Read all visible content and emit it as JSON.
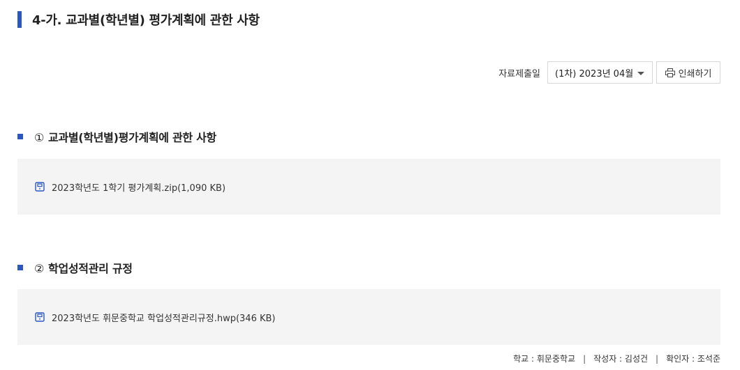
{
  "title": "4-가. 교과별(학년별) 평가계획에 관한 사항",
  "toolbar": {
    "submit_date_label": "자료제출일",
    "selected_period": "(1차) 2023년 04월",
    "print_label": "인쇄하기"
  },
  "sections": [
    {
      "number": "①",
      "heading": "교과별(학년별)평가계획에 관한 사항",
      "file": "2023학년도 1학기 평가계획.zip(1,090 KB)"
    },
    {
      "number": "②",
      "heading": "학업성적관리 규정",
      "file": "2023학년도 휘문중학교 학업성적관리규정.hwp(346 KB)"
    }
  ],
  "footer": {
    "school": "학교 : 휘문중학교",
    "author": "작성자 : 김성건",
    "confirmer": "확인자 : 조석준"
  },
  "colors": {
    "accent": "#2b57c4",
    "box_bg": "#f4f4f4"
  }
}
